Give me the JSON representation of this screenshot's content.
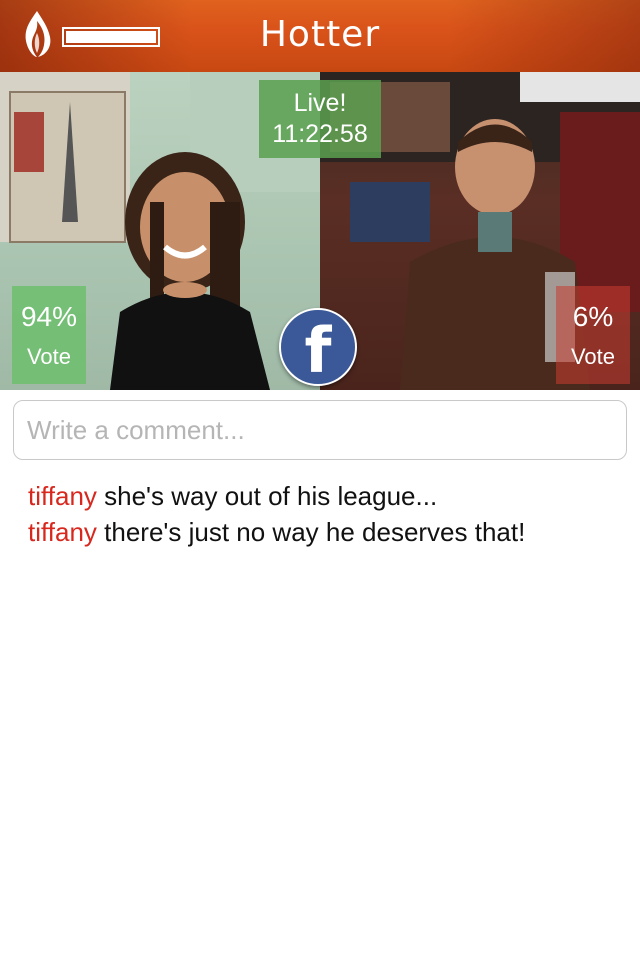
{
  "header": {
    "title": "Hotter",
    "logo_icon": "flame-icon",
    "progress": 1.0
  },
  "live": {
    "label": "Live!",
    "timer": "11:22:58"
  },
  "vote_left": {
    "percent": "94%",
    "label": "Vote"
  },
  "vote_right": {
    "percent": "6%",
    "label": "Vote"
  },
  "facebook": {
    "icon": "facebook-icon",
    "glyph": "f"
  },
  "comment_input": {
    "placeholder": "Write a comment...",
    "value": ""
  },
  "comments": [
    {
      "user": "tiffany",
      "text": "she's way out of his league..."
    },
    {
      "user": "tiffany",
      "text": "there's just no way he deserves that!"
    }
  ],
  "colors": {
    "header": "#d9531a",
    "vote_left_bg": "#6ebe6e",
    "vote_right_bg": "#c83c32",
    "username": "#d8281e",
    "facebook": "#3b5998"
  }
}
